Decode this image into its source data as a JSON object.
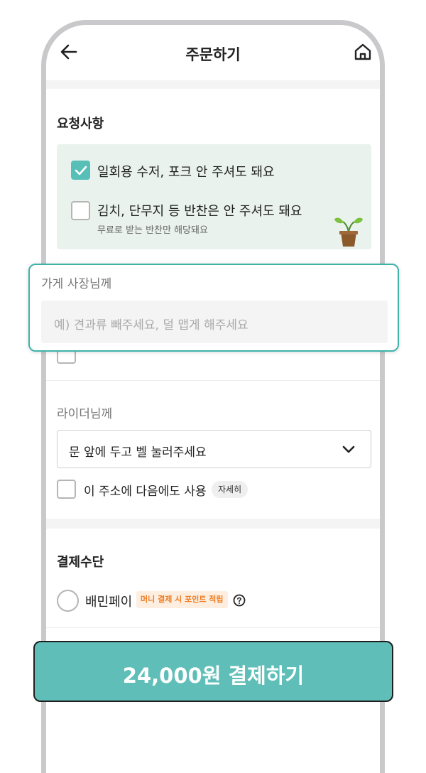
{
  "header": {
    "title": "주문하기",
    "back_icon": "arrow-left-icon",
    "home_icon": "home-icon"
  },
  "requests": {
    "section_title": "요청사항",
    "items": [
      {
        "label": "일회용 수저, 포크 안 주셔도 돼요",
        "checked": true,
        "subtext": ""
      },
      {
        "label": "김치, 단무지 등 반찬은 안 주셔도 돼요",
        "checked": false,
        "subtext": "무료로 받는 반찬만 해당돼요"
      }
    ],
    "illustration": "sprout-icon"
  },
  "owner_note": {
    "label": "가게 사장님께",
    "placeholder": "예) 견과류 빼주세요, 덜 맵게 해주세요"
  },
  "rider_note": {
    "label": "라이더님께",
    "selected": "문 앞에 두고 벨 눌러주세요",
    "remember_label": "이 주소에 다음에도 사용",
    "remember_checked": false,
    "detail_button": "자세히"
  },
  "payment": {
    "section_title": "결제수단",
    "method": "배민페이",
    "promo_badge": "머니 결제 시 포인트 적립",
    "selected": false
  },
  "pay_button": {
    "label": "24,000원 결제하기"
  },
  "colors": {
    "accent": "#5fbfb8",
    "checkbox_checked": "#57bfb7",
    "request_box_bg": "#e9f2ec",
    "promo_text": "#ef7d23",
    "promo_bg": "#fdeee0"
  }
}
